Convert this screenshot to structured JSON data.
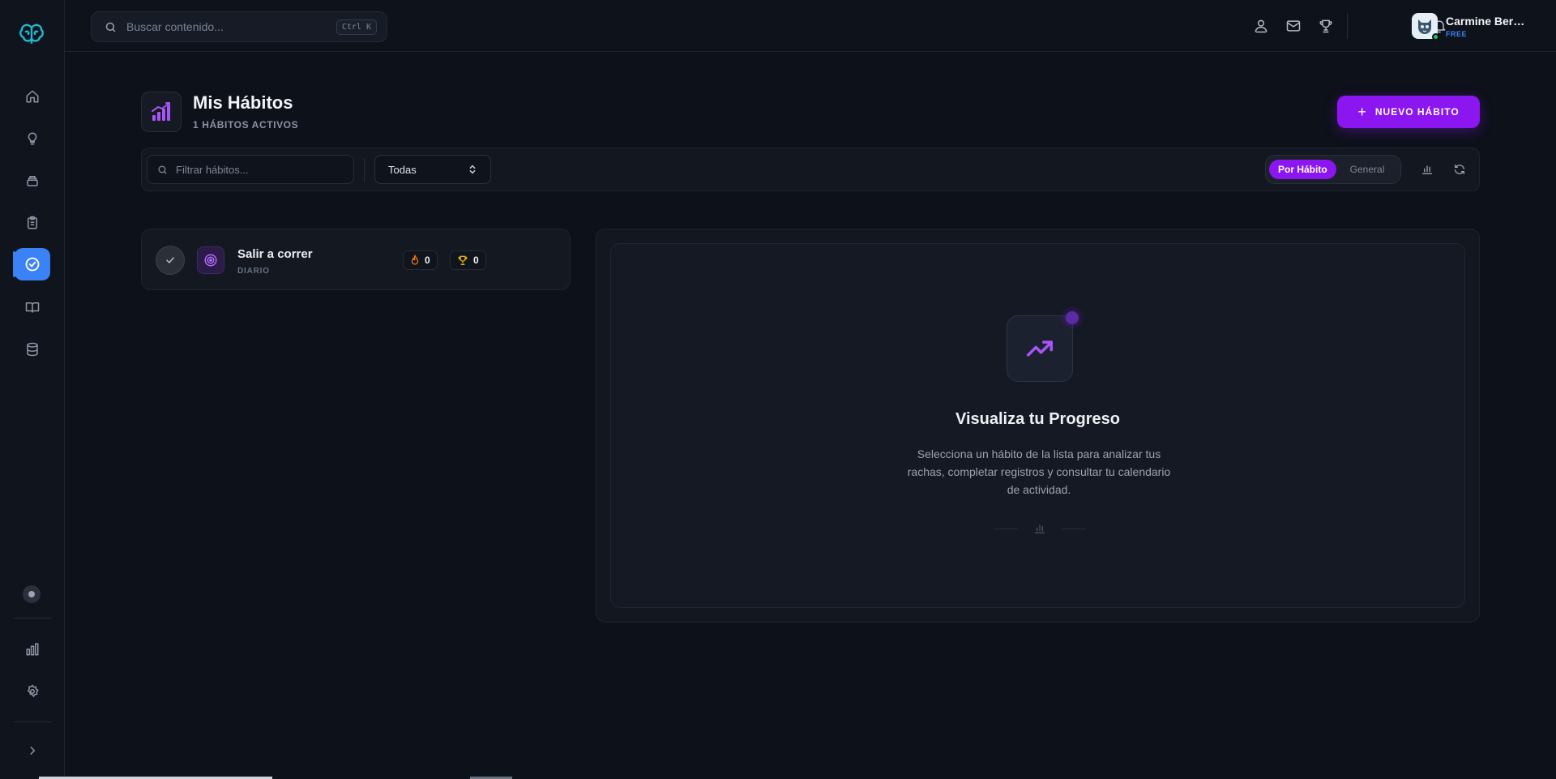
{
  "topbar": {
    "search_placeholder": "Buscar contenido...",
    "shortcut": "Ctrl K",
    "user": {
      "name": "Carmine Bern...",
      "plan": "FREE"
    }
  },
  "header": {
    "title": "Mis Hábitos",
    "subtitle": "1 HÁBITOS ACTIVOS",
    "new_button": "NUEVO HÁBITO"
  },
  "filters": {
    "search_placeholder": "Filtrar hábitos...",
    "category_selected": "Todas",
    "view_toggle": {
      "active": "Por Hábito",
      "inactive": "General"
    }
  },
  "habits": [
    {
      "name": "Salir a correr",
      "frequency": "DIARIO",
      "streak": "0",
      "best": "0"
    }
  ],
  "panel": {
    "title": "Visualiza tu Progreso",
    "description": "Selecciona un hábito de la lista para analizar tus rachas, completar registros y consultar tu calendario de actividad."
  },
  "colors": {
    "accent": "#8b16f0",
    "active_nav": "#3b82f6",
    "background": "#0d111a",
    "flame": "#f97316",
    "trophy": "#eab308"
  }
}
